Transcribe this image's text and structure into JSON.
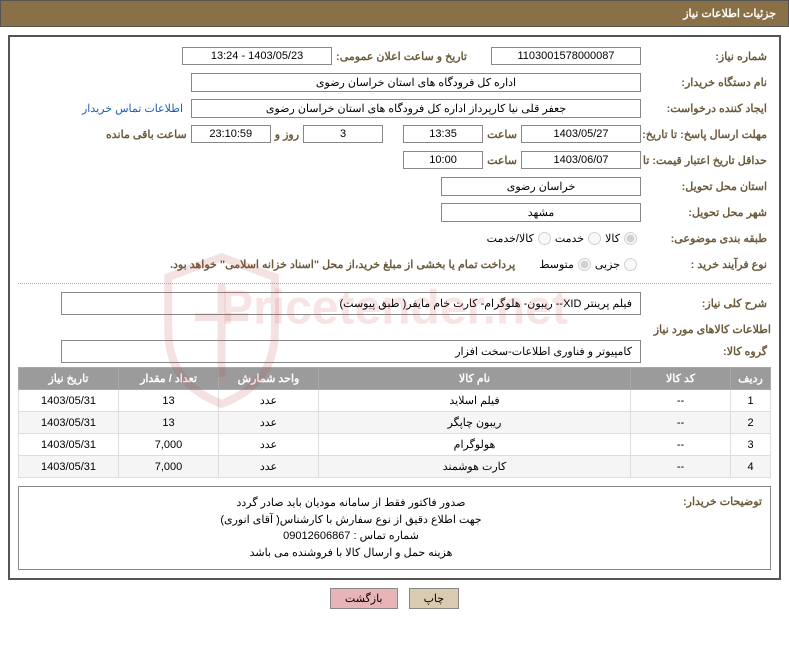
{
  "header": {
    "title": "جزئیات اطلاعات نیاز"
  },
  "fields": {
    "need_no_label": "شماره نیاز:",
    "need_no": "1103001578000087",
    "announce_dt_label": "تاریخ و ساعت اعلان عمومی:",
    "announce_dt": "1403/05/23 - 13:24",
    "buyer_label": "نام دستگاه خریدار:",
    "buyer": "اداره کل فرودگاه های استان خراسان رضوی",
    "requester_label": "ایجاد کننده درخواست:",
    "requester": "جعفر قلی نیا کارپرداز اداره کل فرودگاه های استان خراسان رضوی",
    "contact_link": "اطلاعات تماس خریدار",
    "deadline_label": "مهلت ارسال پاسخ: تا تاریخ:",
    "deadline_date": "1403/05/27",
    "time_label": "ساعت",
    "deadline_time": "13:35",
    "remaining_days": "3",
    "days_and": "روز و",
    "remaining_time": "23:10:59",
    "remaining_label": "ساعت باقی مانده",
    "validity_label": "حداقل تاریخ اعتبار قیمت: تا تاریخ:",
    "validity_date": "1403/06/07",
    "validity_time": "10:00",
    "province_label": "استان محل تحویل:",
    "province": "خراسان رضوی",
    "city_label": "شهر محل تحویل:",
    "city": "مشهد",
    "category_label": "طبقه بندی موضوعی:",
    "opt_goods": "کالا",
    "opt_service": "خدمت",
    "opt_both": "کالا/خدمت",
    "process_label": "نوع فرآیند خرید :",
    "opt_partial": "جزیی",
    "opt_medium": "متوسط",
    "treasury_note": "پرداخت تمام یا بخشی از مبلغ خرید،از محل \"اسناد خزانه اسلامی\" خواهد بود.",
    "general_desc_label": "شرح کلی نیاز:",
    "general_desc": "فیلم پرینتر XID-- ریبون- هلوگرام- کارت خام مایفر( طبق پیوست)",
    "goods_info_title": "اطلاعات کالاهای مورد نیاز",
    "group_label": "گروه کالا:",
    "group_value": "کامپیوتر و فناوری اطلاعات-سخت افزار"
  },
  "table": {
    "headers": {
      "row": "ردیف",
      "code": "کد کالا",
      "name": "نام کالا",
      "unit": "واحد شمارش",
      "qty": "تعداد / مقدار",
      "date": "تاریخ نیاز"
    },
    "rows": [
      {
        "row": "1",
        "code": "--",
        "name": "فیلم اسلاید",
        "unit": "عدد",
        "qty": "13",
        "date": "1403/05/31"
      },
      {
        "row": "2",
        "code": "--",
        "name": "ریبون چاپگر",
        "unit": "عدد",
        "qty": "13",
        "date": "1403/05/31"
      },
      {
        "row": "3",
        "code": "--",
        "name": "هولوگرام",
        "unit": "عدد",
        "qty": "7,000",
        "date": "1403/05/31"
      },
      {
        "row": "4",
        "code": "--",
        "name": "کارت هوشمند",
        "unit": "عدد",
        "qty": "7,000",
        "date": "1403/05/31"
      }
    ]
  },
  "buyer_notes": {
    "label": "توضیحات خریدار:",
    "line1": "صدور فاکتور فقط از سامانه مودیان باید صادر گردد",
    "line2": "جهت اطلاع دقیق از نوع سفارش با کارشناس( آقای انوری)",
    "line3": "شماره تماس : 09012606867",
    "line4": "هزینه حمل و ارسال کالا با فروشنده می باشد"
  },
  "buttons": {
    "print": "چاپ",
    "back": "بازگشت"
  }
}
